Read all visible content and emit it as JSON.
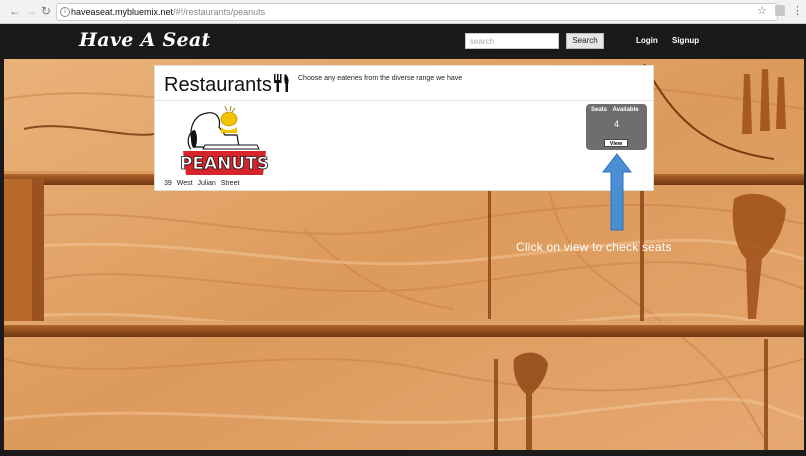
{
  "browser": {
    "url_host": "haveaseat.mybluemix.net",
    "url_path": "/#!/restaurants/peanuts",
    "back_icon": "arrow-left-icon",
    "forward_icon": "arrow-right-icon",
    "reload_icon": "reload-icon"
  },
  "header": {
    "brand": "Have A Seat",
    "search_placeholder": "search",
    "search_button": "Search",
    "login": "Login",
    "signup": "Signup"
  },
  "card": {
    "title": "Restaurants",
    "subtitle": "Choose any eateries from the diverse range we have",
    "logo_text": "PEANUTS",
    "address": "39 West Julian Street",
    "seats_label": "Seats Available",
    "seats_count": "4",
    "view_button": "View"
  },
  "annotation": {
    "text": "Click on view to check seats",
    "arrow_color": "#4a8fd6"
  },
  "colors": {
    "header_bg": "#1a1a1a",
    "wood": "#e0a064",
    "seats_box": "#6e6e6e",
    "logo_red": "#d6242b"
  }
}
